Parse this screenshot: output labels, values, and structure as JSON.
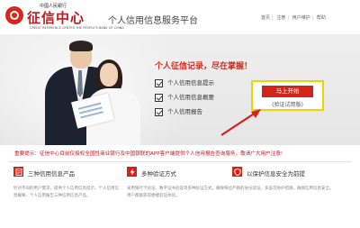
{
  "header": {
    "logo_top": "中國人民銀行",
    "logo_main": "征信中心",
    "logo_en": "CREDIT REFERENCE CENTER THE PEOPLE'S BANK OF CHINA",
    "title": "个人信用信息服务平台",
    "links": [
      "首页",
      "注册",
      "用户维护",
      "帮助"
    ]
  },
  "banner": {
    "slogan": "个人征信记录，尽在掌握！",
    "items": [
      "个人信用信息提示",
      "个人信用信息概要",
      "个人信用报告"
    ],
    "start_button": "马上开始",
    "start_sub": "(验证试用版)"
  },
  "notice": {
    "text": "重要提示：征信中心目前仅授权全国性商业银行及中国银联的APP客户端提供个人信用报告查询服务，敬请广大用户注意!"
  },
  "features": [
    {
      "title": "三种信用信息产品",
      "icon": "document-icon",
      "desc": "针对不同的用户需求，提供个人信用信息提示、个人信用信息概要、个人信用报告三种信用信息产品。"
    },
    {
      "title": "多种验证方式",
      "icon": "bolt-icon",
      "desc": "采用银行卡验证、数字证书验证等多种验证方式，确保每位用户都能获得便捷验证体验。"
    },
    {
      "title": "以保护信息安全为前提",
      "icon": "shield-icon",
      "desc": "严格的身份验证，多层次防护措施，确保信用信息安全。"
    }
  ],
  "colors": {
    "brand_red": "#d3241b",
    "highlight_yellow": "#f2d100",
    "banner_bg": "#eeeeee"
  }
}
